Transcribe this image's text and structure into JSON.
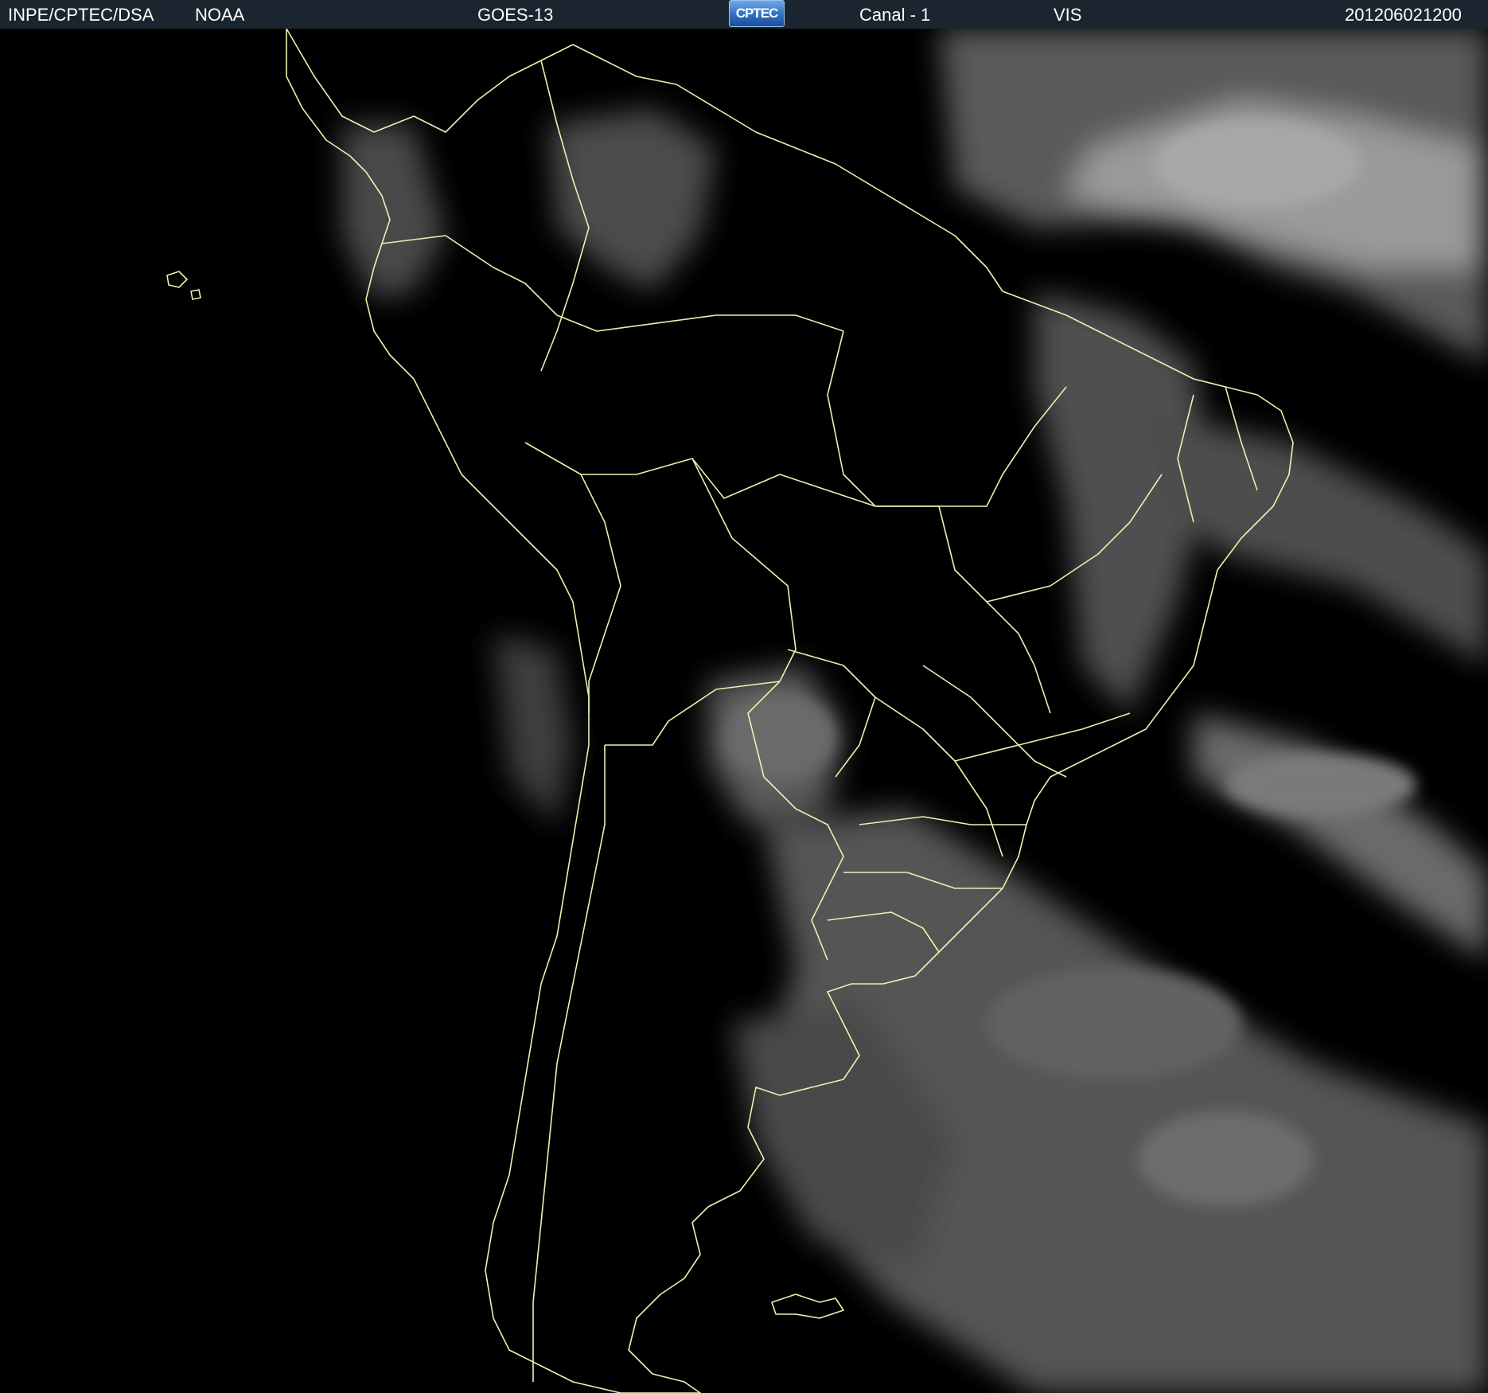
{
  "header": {
    "source": "INPE/CPTEC/DSA",
    "agency": "NOAA",
    "satellite": "GOES-13",
    "logo_text": "CPTEC",
    "channel": "Canal - 1",
    "band": "VIS",
    "timestamp": "201206021200"
  },
  "map": {
    "type": "satellite-visible-image",
    "region": "South America",
    "background_color": "#000000",
    "border_color": "#f2eeb0",
    "cloud_color": "#8a8a8a"
  }
}
